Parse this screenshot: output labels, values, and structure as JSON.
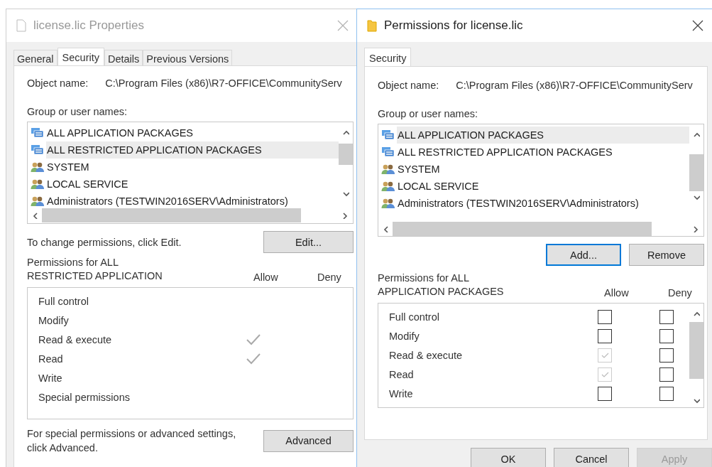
{
  "dialogs": [
    {
      "kind": "properties",
      "title": "license.lic Properties",
      "active": false,
      "tabs": [
        {
          "label": "General",
          "selected": false
        },
        {
          "label": "Security",
          "selected": true
        },
        {
          "label": "Details",
          "selected": false
        },
        {
          "label": "Previous Versions",
          "selected": false
        }
      ],
      "object_label": "Object name:",
      "object_value": "C:\\Program Files (x86)\\R7-OFFICE\\CommunityServ",
      "group_label": "Group or user names:",
      "principals": [
        {
          "name": "ALL APPLICATION PACKAGES",
          "kind": "package",
          "selected": false
        },
        {
          "name": "ALL RESTRICTED APPLICATION PACKAGES",
          "kind": "package",
          "selected": true
        },
        {
          "name": "SYSTEM",
          "kind": "users",
          "selected": false
        },
        {
          "name": "LOCAL SERVICE",
          "kind": "users",
          "selected": false
        },
        {
          "name": "Administrators (TESTWIN2016SERV\\Administrators)",
          "kind": "users",
          "selected": false
        }
      ],
      "change_hint": "To change permissions, click Edit.",
      "list_buttons": [
        {
          "label": "Edit...",
          "focused": false
        }
      ],
      "permissions_label": "Permissions for ALL\nRESTRICTED APPLICATION",
      "allow_header": "Allow",
      "deny_header": "Deny",
      "permissions": [
        {
          "name": "Full control",
          "allow": false
        },
        {
          "name": "Modify",
          "allow": false
        },
        {
          "name": "Read & execute",
          "allow": true
        },
        {
          "name": "Read",
          "allow": true
        },
        {
          "name": "Write",
          "allow": false
        },
        {
          "name": "Special permissions",
          "allow": false
        }
      ],
      "advanced_hint": "For special permissions or advanced settings,\nclick Advanced.",
      "advanced_button": "Advanced"
    },
    {
      "kind": "editor",
      "title": "Permissions for license.lic",
      "active": true,
      "tabs": [
        {
          "label": "Security",
          "selected": true
        }
      ],
      "object_label": "Object name:",
      "object_value": "C:\\Program Files (x86)\\R7-OFFICE\\CommunityServ",
      "group_label": "Group or user names:",
      "principals": [
        {
          "name": "ALL APPLICATION PACKAGES",
          "kind": "package",
          "selected": true
        },
        {
          "name": "ALL RESTRICTED APPLICATION PACKAGES",
          "kind": "package",
          "selected": false
        },
        {
          "name": "SYSTEM",
          "kind": "users",
          "selected": false
        },
        {
          "name": "LOCAL SERVICE",
          "kind": "users",
          "selected": false
        },
        {
          "name": "Administrators (TESTWIN2016SERV\\Administrators)",
          "kind": "users",
          "selected": false
        }
      ],
      "list_buttons": [
        {
          "label": "Add...",
          "focused": true
        },
        {
          "label": "Remove",
          "focused": false
        }
      ],
      "permissions_label": "Permissions for ALL\nAPPLICATION PACKAGES",
      "allow_header": "Allow",
      "deny_header": "Deny",
      "permissions": [
        {
          "name": "Full control",
          "allow": false,
          "deny": false,
          "inherited": false
        },
        {
          "name": "Modify",
          "allow": false,
          "deny": false,
          "inherited": false
        },
        {
          "name": "Read & execute",
          "allow": true,
          "deny": false,
          "inherited": true
        },
        {
          "name": "Read",
          "allow": true,
          "deny": false,
          "inherited": true
        },
        {
          "name": "Write",
          "allow": false,
          "deny": false,
          "inherited": false
        }
      ],
      "footer_buttons": [
        {
          "label": "OK",
          "disabled": false
        },
        {
          "label": "Cancel",
          "disabled": false
        },
        {
          "label": "Apply",
          "disabled": true
        }
      ]
    }
  ]
}
